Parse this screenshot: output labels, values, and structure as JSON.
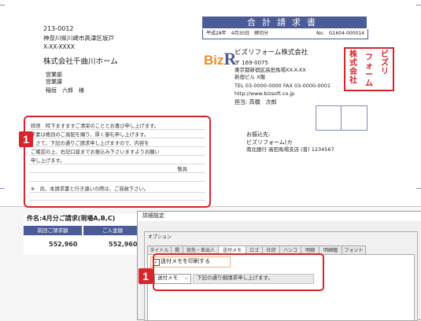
{
  "address": {
    "postal": "213-0012",
    "line1": "神奈川県川崎市高津区坂戸",
    "line2": "X-XX-XXXX",
    "company": "株式会社千曲川ホーム",
    "dept1": "営業部",
    "dept2": "営業課",
    "person": "稲垣　六郎　様"
  },
  "invoice": {
    "title": "合計請求書",
    "date": "平成28年　4月30日　締切分",
    "number": "No.　G1604-000014"
  },
  "issuer": {
    "logo_biz": "Biz",
    "logo_r": "R",
    "name": "ビズリフォーム株式会社",
    "postal": "〒 169-0075",
    "address1": "東京都新宿区高田馬場XX-X-XX",
    "address2": "新宿ビル X階",
    "phone_fax": "TEL 03-0000-0000  FAX 03-0000-0001",
    "url": "http://www.bizsoft.co.jp",
    "contact": "担当: 高橋　次郎",
    "stamp": "株式会社 ビズリフォーム"
  },
  "bank": {
    "label": "お振込先:",
    "name": "ビズリフォーム(カ",
    "account": "南北銀行 高田馬場支店 (普) 1234567"
  },
  "message": {
    "lines": [
      "拝啓　時下ますますご清栄のこととお喜び申し上げます。",
      "平素は格別のご高配を賜り、厚く御礼申し上げます。",
      "　さて、下記の通りご請求申し上げますので、内容を",
      "ご確認の上、右記口座までお振込み下さいますようお願い",
      "申し上げます。"
    ],
    "closing": "敬具",
    "footnote": "※　尚、本請求書と行き違いの際は、ご容赦下さい。"
  },
  "badge": "1",
  "summary": {
    "subject": "件名:4月分ご請求(現場A,B,C)",
    "col1": "前回ご請求額",
    "col2": "ご入金額",
    "val1": "552,960",
    "val2": "552,960"
  },
  "dialog": {
    "title": "詳細設定",
    "group": "オプション",
    "tabs": [
      "タイトル",
      "掲",
      "宛先・差出人",
      "送付メモ",
      "ロゴ",
      "社印",
      "ハンコ",
      "明細",
      "明細幅",
      "フォント"
    ],
    "checkbox_label": "送付メモを印刷する",
    "checkbox_checked": true,
    "select_value": "送付メモ",
    "memo_text": "下記の通り御請求申し上げます。"
  },
  "colors": {
    "accent": "#4b5b98",
    "highlight": "#d9232d",
    "logo_orange": "#f08c28"
  }
}
